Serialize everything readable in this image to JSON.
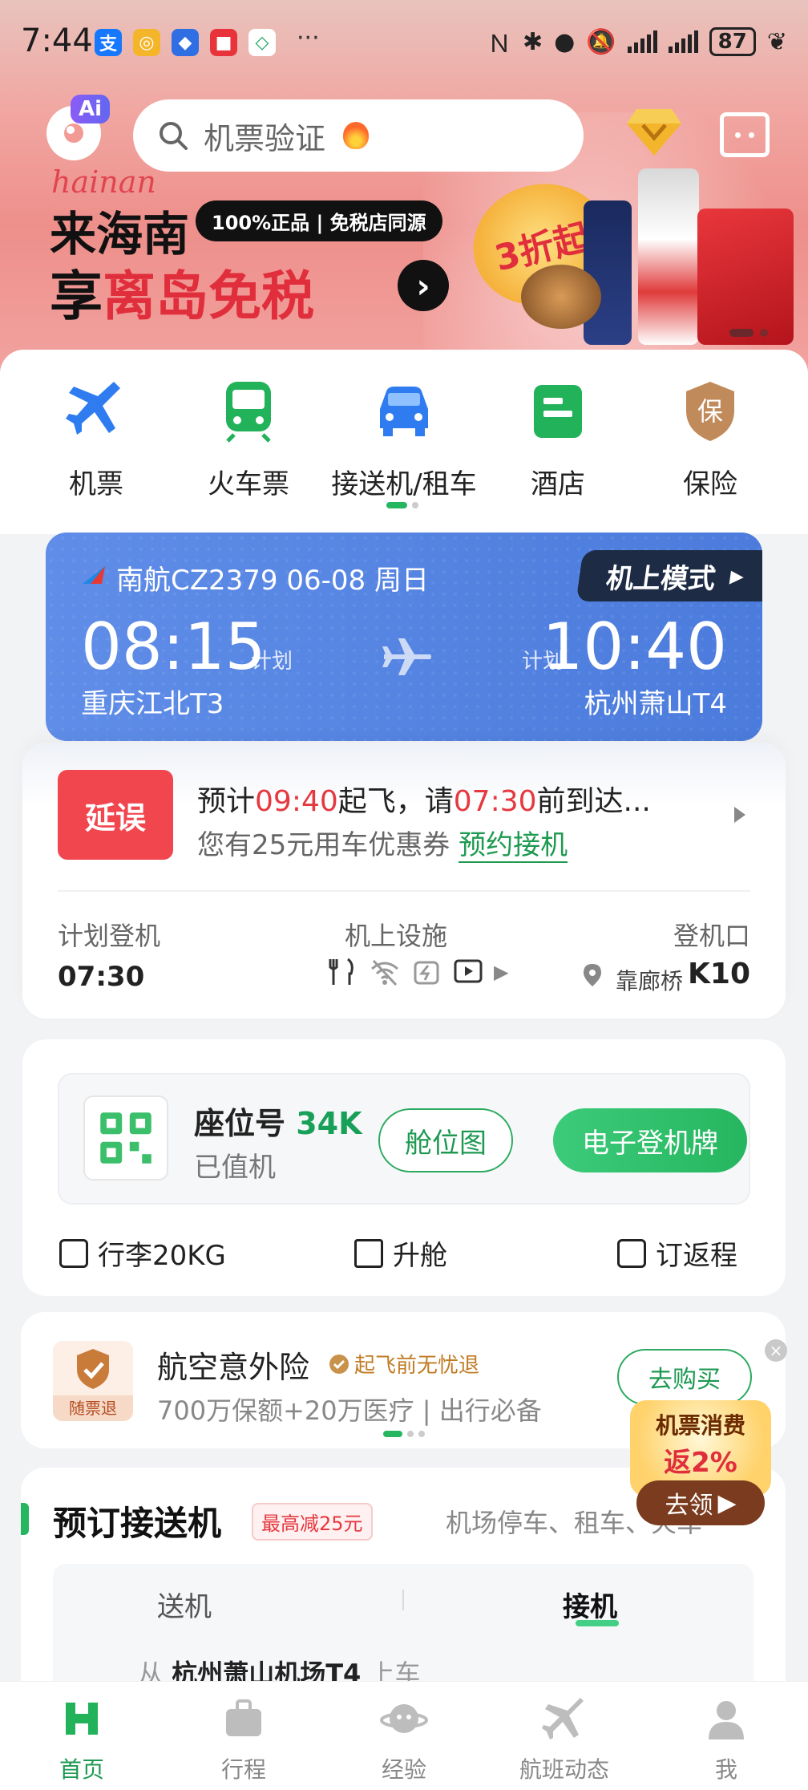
{
  "status_bar": {
    "time": "7:44",
    "apps": [
      "支",
      "◎",
      "◆",
      "■",
      "◇"
    ],
    "more": "···",
    "battery": "87"
  },
  "header": {
    "ai_badge": "Ai",
    "search_placeholder": "机票验证"
  },
  "banner": {
    "script_text": "hainan",
    "line1": "来海南",
    "pill": "100%正品 | 免税店同源",
    "line2_prefix": "享",
    "line2_highlight": "离岛免税",
    "discount": "3折起"
  },
  "quick_nav": {
    "items": [
      {
        "label": "机票",
        "icon": "plane-icon"
      },
      {
        "label": "火车票",
        "icon": "train-icon"
      },
      {
        "label": "接送机/租车",
        "icon": "car-icon"
      },
      {
        "label": "酒店",
        "icon": "hotel-icon"
      },
      {
        "label": "保险",
        "icon": "insurance-icon"
      }
    ]
  },
  "flight": {
    "header": "南航CZ2379 06-08 周日",
    "mode_pill": "机上模式",
    "dep_time": "08:15",
    "dep_plan": "计划",
    "dep_airport": "重庆江北T3",
    "arr_time": "10:40",
    "arr_plan": "计划",
    "arr_airport": "杭州萧山T4"
  },
  "status": {
    "badge": "延误",
    "line1_a": "预计",
    "line1_time1": "09:40",
    "line1_b": "起飞，请",
    "line1_time2": "07:30",
    "line1_c": "前到达...",
    "line2_a": "您有25元用车优惠券 ",
    "line2_link": "预约接机",
    "boarding_label": "计划登机",
    "boarding_value": "07:30",
    "facilities_label": "机上设施",
    "gate_label": "登机口",
    "gate_type": "靠廊桥",
    "gate_value": "K10"
  },
  "seat": {
    "label": "座位号 ",
    "number": "34K",
    "status": "已值机",
    "btn_map": "舱位图",
    "btn_pass": "电子登机牌",
    "actions": [
      "行李20KG",
      "升舱",
      "订返程"
    ]
  },
  "insurance": {
    "tag": "随票退",
    "title": "航空意外险",
    "badge": "起飞前无忧退",
    "sub": "700万保额+20万医疗 | 出行必备",
    "button": "去购买"
  },
  "promo": {
    "line1": "机票消费",
    "line2": "返2%",
    "button": "去领"
  },
  "transfer": {
    "title": "预订接送机",
    "badge": "最高减25元",
    "sub": "机场停车、租车、火车",
    "tab_send": "送机",
    "tab_pick": "接机",
    "from_prefix": "从 ",
    "from_place": "杭州萧山机场T4",
    "from_suffix": " 上车"
  },
  "tabbar": {
    "items": [
      "首页",
      "行程",
      "经验",
      "航班动态",
      "我"
    ]
  },
  "colors": {
    "brand_green": "#26b65f",
    "delay_red": "#f2464f",
    "flight_blue": "#4b7bdc"
  }
}
